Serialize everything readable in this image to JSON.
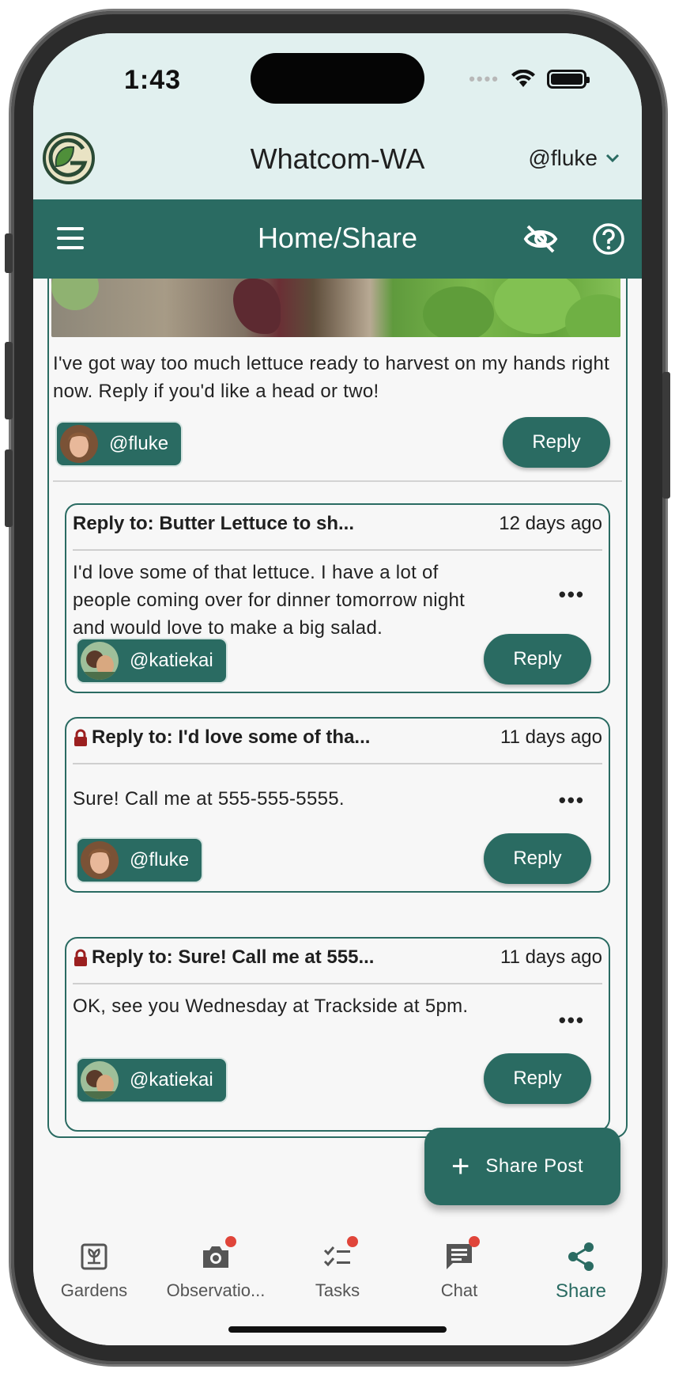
{
  "status_bar": {
    "time": "1:43"
  },
  "header": {
    "org_title": "Whatcom-WA",
    "user_menu": "@fluke"
  },
  "toolbar": {
    "title": "Home/Share"
  },
  "post": {
    "text": "I've got way too much lettuce ready to harvest on my hands right now. Reply if you'd like a head or two!",
    "author": "@fluke",
    "reply_label": "Reply"
  },
  "replies": [
    {
      "heading": "Reply to: Butter Lettuce to sh...",
      "date": "12 days ago",
      "text": "I'd love some of that lettuce. I have a lot of people coming over for dinner tomorrow night and would love to make a big salad.",
      "author": "@katiekai",
      "reply_label": "Reply",
      "more": "•••",
      "locked": false
    },
    {
      "heading": "Reply to: I'd love some of tha...",
      "date": "11 days ago",
      "text": "Sure! Call me at 555-555-5555.",
      "author": "@fluke",
      "reply_label": "Reply",
      "more": "•••",
      "locked": true
    },
    {
      "heading": "Reply to: Sure! Call me at 555...",
      "date": "11 days ago",
      "text": "OK, see you Wednesday at Trackside at 5pm.",
      "author": "@katiekai",
      "reply_label": "Reply",
      "more": "•••",
      "locked": true
    }
  ],
  "fab": {
    "icon": "+",
    "label": "Share Post"
  },
  "bottom_nav": [
    {
      "label": "Gardens",
      "icon": "garden-icon",
      "badge": false
    },
    {
      "label": "Observatio...",
      "icon": "camera-icon",
      "badge": true
    },
    {
      "label": "Tasks",
      "icon": "tasks-icon",
      "badge": true
    },
    {
      "label": "Chat",
      "icon": "chat-icon",
      "badge": true
    },
    {
      "label": "Share",
      "icon": "share-icon",
      "badge": false,
      "active": true
    }
  ],
  "colors": {
    "primary": "#2a6b62",
    "header_bg": "#e1f0ef",
    "badge": "#e0453a"
  }
}
